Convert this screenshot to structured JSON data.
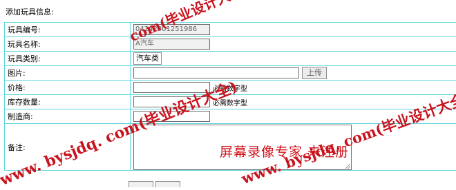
{
  "page_heading": "添加玩具信息:",
  "form": {
    "toy_id": {
      "label": "玩具编号:",
      "value": "04242301251986"
    },
    "toy_name": {
      "label": "玩具名称:",
      "value": "A汽车"
    },
    "toy_category": {
      "label": "玩具类别:",
      "selected": "汽车类"
    },
    "image": {
      "label": "图片:",
      "value": "",
      "upload_label": "上传"
    },
    "price": {
      "label": "价格:",
      "value": "",
      "hint": "必需数字型"
    },
    "stock": {
      "label": "库存数量:",
      "value": "",
      "hint": "必需数字型"
    },
    "manufacturer": {
      "label": "制造商:",
      "value": ""
    },
    "notes": {
      "label": "备注:",
      "value": ""
    }
  },
  "watermarks": {
    "site_mark_1": "www. bysjdq. com(毕业设计大全)",
    "site_mark_2": "com(毕业设计大全)",
    "site_mark_3": "www. bysjdq. com(毕业设计大全)",
    "recorder_notice": "屏幕录像专家  未注册"
  }
}
